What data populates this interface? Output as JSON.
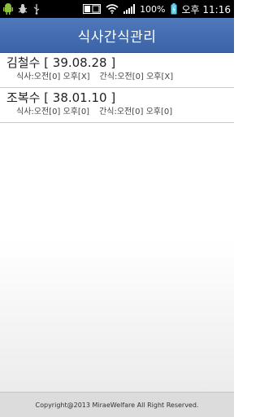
{
  "status_bar": {
    "battery_percent": "100%",
    "time": "오후 11:16"
  },
  "header": {
    "title": "식사간식관리"
  },
  "people": [
    {
      "name_dob": "김철수 [ 39.08.28 ]",
      "meal": "식사:오전[0] 오후[X]",
      "snack": "간식:오전[0] 오후[X]"
    },
    {
      "name_dob": "조복수 [ 38.01.10 ]",
      "meal": "식사:오전[0] 오후[0]",
      "snack": "간식:오전[0] 오후[0]"
    }
  ],
  "footer": {
    "copyright": "Copyright@2013 MiraeWelfare All Right Reserved."
  }
}
